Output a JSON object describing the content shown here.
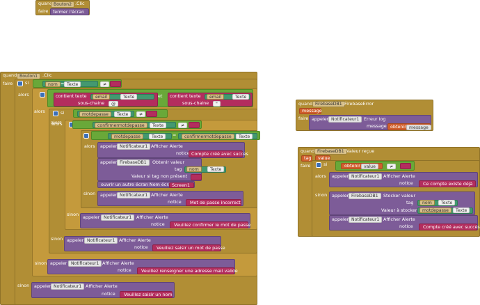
{
  "kw": {
    "quand": "quand",
    "faire": "faire",
    "si": "si",
    "alors": "alors",
    "sinon": "sinon",
    "appeler": "appeler",
    "et": "et",
    "eq": "=",
    "eq_sign": "≠",
    "quote": "\"",
    "texte": "Texte",
    "texte_l": "texte",
    "sous_chaine": "sous-chaine",
    "contient": "contient",
    "obtenir": "obtenir",
    "message": "message",
    "tag": "tag",
    "value": "value",
    "value_l": "valeur"
  },
  "block_bouton2": {
    "component": "Bouton2",
    "event": ".Clic",
    "action": "fermer l'écran"
  },
  "block_bouton1": {
    "component": "Bouton1",
    "event": ".Clic",
    "nom": "nom",
    "email": "email",
    "at": "@",
    "motdepasse": "motdepasse",
    "confirmer": "confirmermotdepasse",
    "notificateur": "Notificateur1",
    "afficher": "Afficher Alerte",
    "notice": "notice",
    "firebase": "FirebaseDB1",
    "obtenir_valeur": "Obtenir valeur",
    "valeur_absent": "Valeur si tag non présent",
    "ouvrir": "ouvrir un autre écran  Nom écran",
    "screen": "Screen1",
    "msg_succes": "Compte créé avec succes",
    "msg_incorrect": "Mot de passe incorrect",
    "msg_confirmer": "Veuillez confirmer le mot de passe",
    "msg_saisir_mdp": "Veuillez saisir un mot de passe",
    "msg_email": "Veuillez renseigner une adresse mail valide",
    "msg_nom": "Veuillez saisir un nom"
  },
  "block_error": {
    "component": "FirebaseDB1",
    "event": ".FirebaseError",
    "param": "message",
    "notificateur": "Notificateur1",
    "erreur_log": "Erreur log"
  },
  "block_valeur": {
    "component": "FirebaseDB1",
    "event": ".Valeur reçue",
    "param1": "tag",
    "param2": "value",
    "notificateur": "Notificateur1",
    "afficher": "Afficher Alerte",
    "notice": "notice",
    "msg_existe": "Ce compte existe déjà",
    "stocker": "Stocker valeur",
    "valeur_a_stocker": "Valeur à stocker",
    "nom": "nom",
    "motdepasse": "motdepasse",
    "msg_cree": "Compte créé avec succès"
  }
}
